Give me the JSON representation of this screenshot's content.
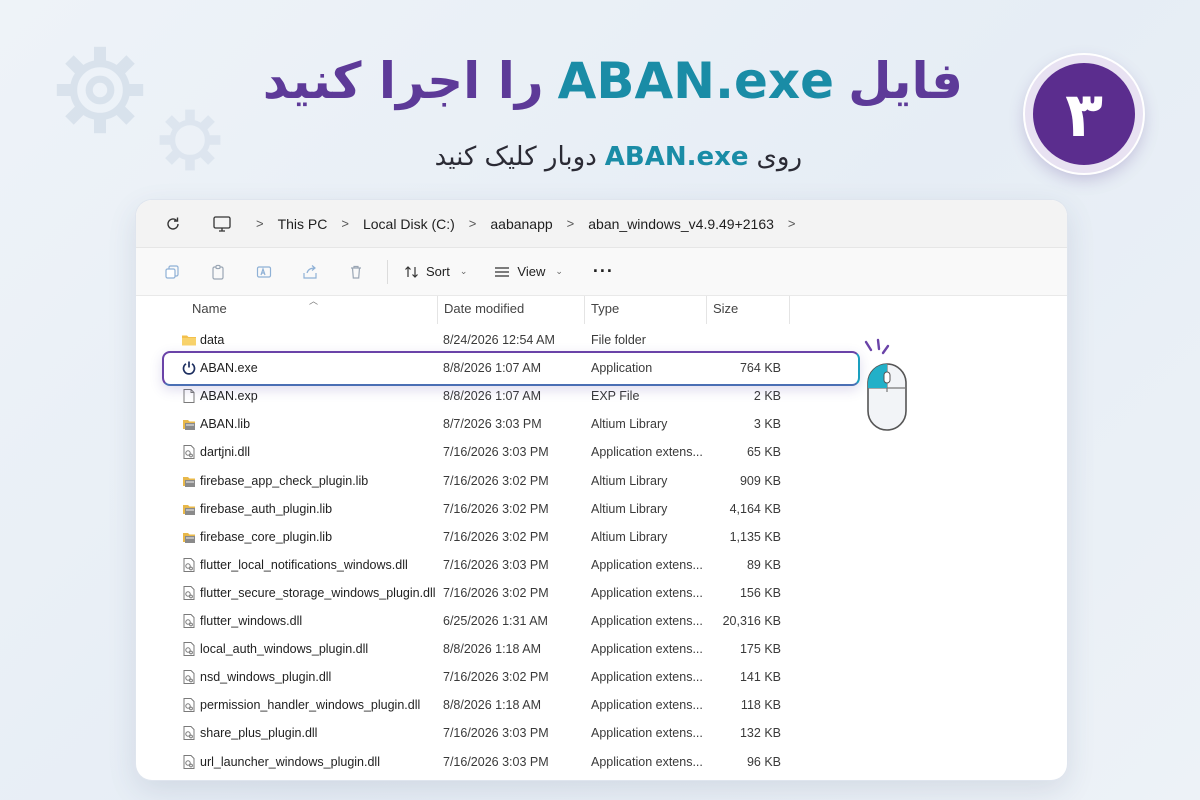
{
  "header": {
    "title_pre": "فایل",
    "title_exe": "ABAN.exe",
    "title_post": "را اجرا کنید",
    "subtitle_pre": "روی",
    "subtitle_exe": "ABAN.exe",
    "subtitle_post": "دوبار کلیک کنید",
    "step_number": "۳"
  },
  "colors": {
    "purple": "#5d3a98",
    "teal": "#1a8ca6",
    "badge": "#5b2d8e"
  },
  "address": {
    "crumbs": [
      "This PC",
      "Local Disk (C:)",
      "aabanapp",
      "aban_windows_v4.9.49+2163"
    ],
    "separator": ">"
  },
  "toolbar": {
    "sort_label": "Sort",
    "view_label": "View",
    "more_label": "···",
    "icons": [
      "copy-icon",
      "paste-icon",
      "rename-icon",
      "share-icon",
      "delete-icon"
    ]
  },
  "columns": {
    "name": "Name",
    "date": "Date modified",
    "type": "Type",
    "size": "Size"
  },
  "files": [
    {
      "name": "data",
      "date": "8/24/2026 12:54 AM",
      "type": "File folder",
      "size": "",
      "icon": "folder-icon"
    },
    {
      "name": "ABAN.exe",
      "date": "8/8/2026 1:07 AM",
      "type": "Application",
      "size": "764 KB",
      "icon": "power-icon"
    },
    {
      "name": "ABAN.exp",
      "date": "8/8/2026 1:07 AM",
      "type": "EXP File",
      "size": "2 KB",
      "icon": "file-icon"
    },
    {
      "name": "ABAN.lib",
      "date": "8/7/2026 3:03 PM",
      "type": "Altium Library",
      "size": "3 KB",
      "icon": "library-icon"
    },
    {
      "name": "dartjni.dll",
      "date": "7/16/2026 3:03 PM",
      "type": "Application extens...",
      "size": "65 KB",
      "icon": "dll-icon"
    },
    {
      "name": "firebase_app_check_plugin.lib",
      "date": "7/16/2026 3:02 PM",
      "type": "Altium Library",
      "size": "909 KB",
      "icon": "library-icon"
    },
    {
      "name": "firebase_auth_plugin.lib",
      "date": "7/16/2026 3:02 PM",
      "type": "Altium Library",
      "size": "4,164 KB",
      "icon": "library-icon"
    },
    {
      "name": "firebase_core_plugin.lib",
      "date": "7/16/2026 3:02 PM",
      "type": "Altium Library",
      "size": "1,135 KB",
      "icon": "library-icon"
    },
    {
      "name": "flutter_local_notifications_windows.dll",
      "date": "7/16/2026 3:03 PM",
      "type": "Application extens...",
      "size": "89 KB",
      "icon": "dll-icon"
    },
    {
      "name": "flutter_secure_storage_windows_plugin.dll",
      "date": "7/16/2026 3:02 PM",
      "type": "Application extens...",
      "size": "156 KB",
      "icon": "dll-icon"
    },
    {
      "name": "flutter_windows.dll",
      "date": "6/25/2026 1:31 AM",
      "type": "Application extens...",
      "size": "20,316 KB",
      "icon": "dll-icon"
    },
    {
      "name": "local_auth_windows_plugin.dll",
      "date": "8/8/2026 1:18 AM",
      "type": "Application extens...",
      "size": "175 KB",
      "icon": "dll-icon"
    },
    {
      "name": "nsd_windows_plugin.dll",
      "date": "7/16/2026 3:02 PM",
      "type": "Application extens...",
      "size": "141 KB",
      "icon": "dll-icon"
    },
    {
      "name": "permission_handler_windows_plugin.dll",
      "date": "8/8/2026 1:18 AM",
      "type": "Application extens...",
      "size": "118 KB",
      "icon": "dll-icon"
    },
    {
      "name": "share_plus_plugin.dll",
      "date": "7/16/2026 3:03 PM",
      "type": "Application extens...",
      "size": "132 KB",
      "icon": "dll-icon"
    },
    {
      "name": "url_launcher_windows_plugin.dll",
      "date": "7/16/2026 3:03 PM",
      "type": "Application extens...",
      "size": "96 KB",
      "icon": "dll-icon"
    }
  ]
}
